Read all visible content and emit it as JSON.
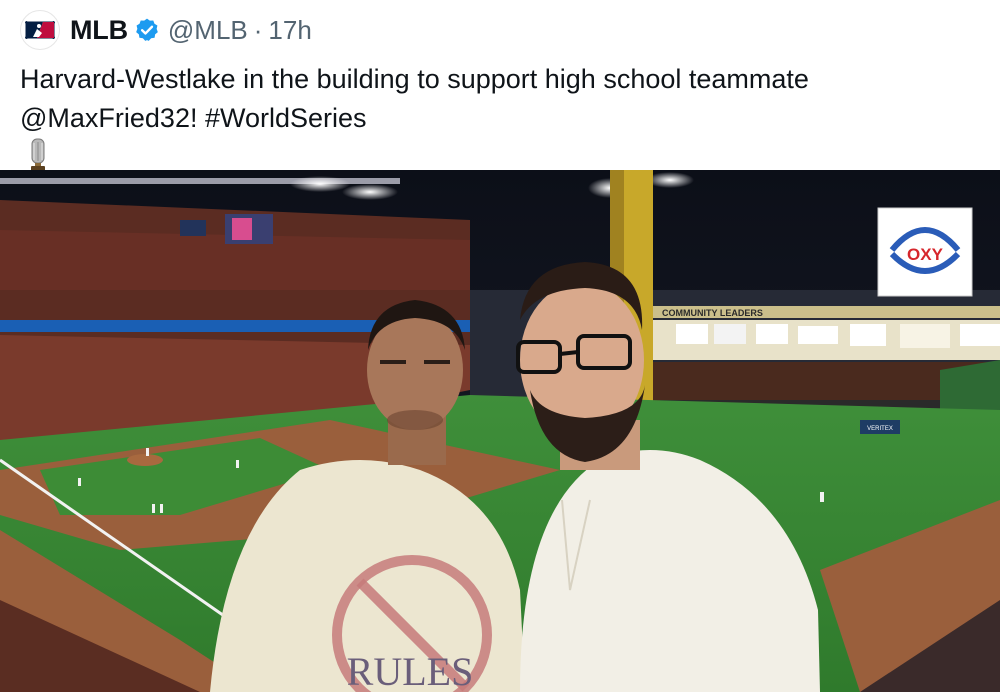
{
  "tweet": {
    "author_name": "MLB",
    "handle": "@MLB",
    "separator": "·",
    "time": "17h",
    "text_line1": "Harvard-Westlake in the building to support high school teammate",
    "text_line2": "@MaxFried32! #WorldSeries",
    "verified_color": "#1d9bf0"
  },
  "photo": {
    "sign_oxy": "OXY",
    "sign_community": "COMMUNITY LEADERS",
    "shirt_text": "RULES",
    "banner_text": "VERITEX"
  },
  "icons": {
    "logo": "mlb-logo-icon",
    "verified": "verified-badge-icon",
    "emoji": "trophy-emoji-icon"
  }
}
